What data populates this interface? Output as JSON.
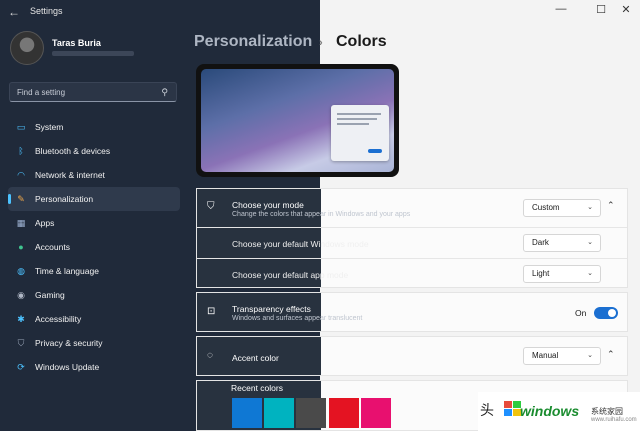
{
  "window": {
    "title": "Settings",
    "back_icon": "←",
    "minimize": "—",
    "maximize": "☐",
    "close": "✕"
  },
  "user": {
    "name": "Taras Buria"
  },
  "search": {
    "placeholder": "Find a setting",
    "icon": "⚲"
  },
  "sidebar": {
    "items": [
      {
        "label": "System",
        "icon": "monitor-icon",
        "glyph": "▭",
        "color": "#4cc2ff"
      },
      {
        "label": "Bluetooth & devices",
        "icon": "bluetooth-icon",
        "glyph": "ᛒ",
        "color": "#4cc2ff"
      },
      {
        "label": "Network & internet",
        "icon": "wifi-icon",
        "glyph": "◠",
        "color": "#4cc2ff"
      },
      {
        "label": "Personalization",
        "icon": "brush-icon",
        "glyph": "✎",
        "color": "#f0a84a",
        "active": true
      },
      {
        "label": "Apps",
        "icon": "apps-icon",
        "glyph": "▦",
        "color": "#9fb4d4"
      },
      {
        "label": "Accounts",
        "icon": "person-icon",
        "glyph": "●",
        "color": "#3fc48f"
      },
      {
        "label": "Time & language",
        "icon": "globe-icon",
        "glyph": "◍",
        "color": "#4cc2ff"
      },
      {
        "label": "Gaming",
        "icon": "gamepad-icon",
        "glyph": "◉",
        "color": "#b0b8c6"
      },
      {
        "label": "Accessibility",
        "icon": "accessibility-icon",
        "glyph": "✱",
        "color": "#4cc2ff"
      },
      {
        "label": "Privacy & security",
        "icon": "shield-icon",
        "glyph": "⛉",
        "color": "#9aa6b8"
      },
      {
        "label": "Windows Update",
        "icon": "update-icon",
        "glyph": "⟳",
        "color": "#4cc2ff"
      }
    ]
  },
  "breadcrumb": {
    "parent": "Personalization",
    "separator": "›",
    "current": "Colors"
  },
  "mode_card": {
    "title": "Choose your mode",
    "subtitle": "Change the colors that appear in Windows and your apps",
    "value": "Custom",
    "windows_mode_label": "Choose your default Windows mode",
    "windows_mode_value": "Dark",
    "app_mode_label": "Choose your default app mode",
    "app_mode_value": "Light"
  },
  "transparency": {
    "title": "Transparency effects",
    "subtitle": "Windows and surfaces appear translucent",
    "state": "On"
  },
  "accent": {
    "title": "Accent color",
    "value": "Manual",
    "recent_label": "Recent colors",
    "recent_colors": [
      "#0f78d4",
      "#00b3c0",
      "#4a4a4a",
      "#e41322",
      "#e8106f"
    ]
  },
  "watermark": {
    "char": "头",
    "brand": "windows",
    "cn": "系统家园",
    "url": "www.ruihafu.com"
  }
}
